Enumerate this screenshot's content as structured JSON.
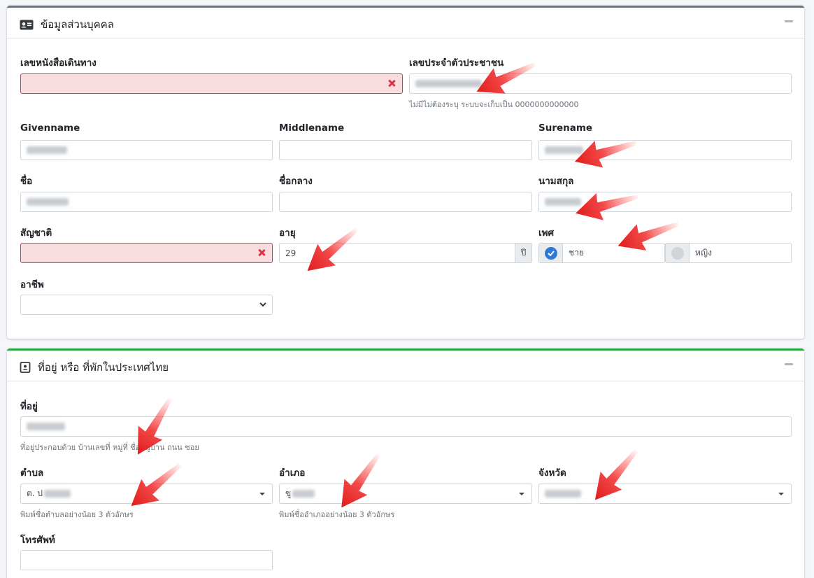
{
  "personal": {
    "title": "ข้อมูลส่วนบุคคล",
    "passport_label": "เลขหนังสือเดินทาง",
    "passport_value": "",
    "idcard_label": "เลขประจำตัวประชาชน",
    "idcard_help": "ไม่มีไม่ต้องระบุ ระบบจะเก็บเป็น 0000000000000",
    "givenname_label": "Givenname",
    "middlename_label": "Middlename",
    "surename_label": "Surename",
    "firstname_th_label": "ชื่อ",
    "middlename_th_label": "ชื่อกลาง",
    "lastname_th_label": "นามสกุล",
    "nationality_label": "สัญชาติ",
    "age_label": "อายุ",
    "age_value": "29",
    "age_unit": "ปี",
    "gender_label": "เพศ",
    "gender_male": "ชาย",
    "gender_female": "หญิง",
    "occupation_label": "อาชีพ"
  },
  "address": {
    "title": "ที่อยู่ หรือ ที่พักในประเทศไทย",
    "address_label": "ที่อยู่",
    "address_help": "ที่อยู่ประกอบด้วย บ้านเลขที่ หมู่ที่ ชื่อหมู่บ้าน ถนน ซอย",
    "subdistrict_label": "ตำบล",
    "subdistrict_prefix": "ต. ป",
    "subdistrict_help": "พิมพ์ชื่อตำบลอย่างน้อย 3 ตัวอักษร",
    "district_label": "อำเภอ",
    "district_prefix": "ขู",
    "district_help": "พิมพ์ชื่ออำเภออย่างน้อย 3 ตัวอักษร",
    "province_label": "จังหวัด",
    "phone_label": "โทรศัพท์"
  },
  "colors": {
    "accent_red": "#ec1f1f",
    "invalid_bg": "#f9dcdd",
    "check_blue": "#2f78d6",
    "card2_border": "#28a745"
  }
}
